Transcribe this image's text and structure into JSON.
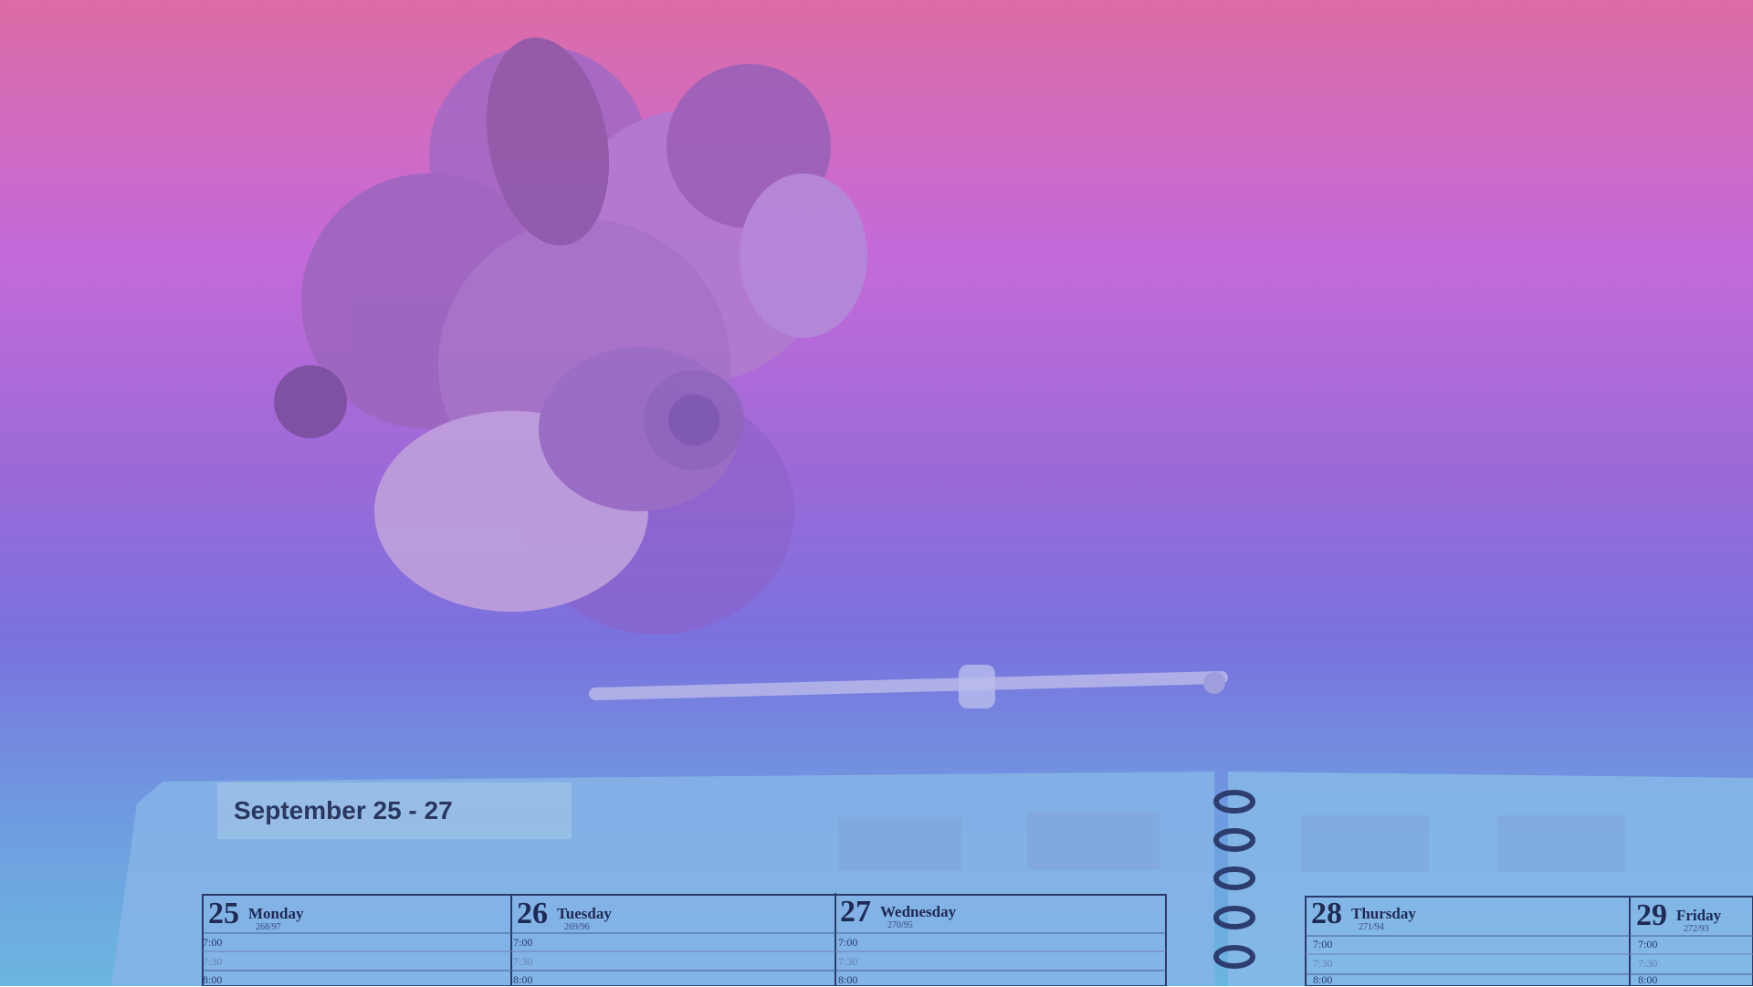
{
  "planner": {
    "title": "September 25 - 27",
    "days": [
      {
        "num": "25",
        "name": "Monday",
        "sub": "268/97"
      },
      {
        "num": "26",
        "name": "Tuesday",
        "sub": "269/96"
      },
      {
        "num": "27",
        "name": "Wednesday",
        "sub": "270/95"
      },
      {
        "num": "28",
        "name": "Thursday",
        "sub": "271/94"
      },
      {
        "num": "29",
        "name": "Friday",
        "sub": "272/93"
      }
    ],
    "times": [
      "7:00",
      "7:30",
      "8:00"
    ]
  },
  "colors": {
    "top": "#dd6ca6",
    "middle": "#9b6ad8",
    "bottom": "#6bb6e0"
  }
}
